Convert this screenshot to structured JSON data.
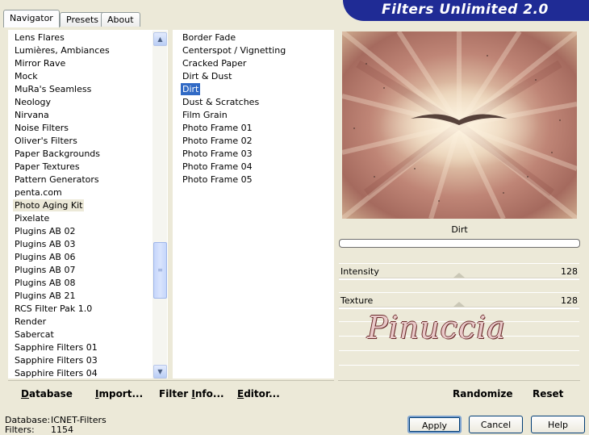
{
  "tabs": [
    "Navigator",
    "Presets",
    "About"
  ],
  "app_title": "Filters Unlimited 2.0",
  "categories": [
    "Lens Flares",
    "Lumières, Ambiances",
    "Mirror Rave",
    "Mock",
    "MuRa's Seamless",
    "Neology",
    "Nirvana",
    "Noise Filters",
    "Oliver's Filters",
    "Paper Backgrounds",
    "Paper Textures",
    "Pattern Generators",
    "penta.com",
    "Photo Aging Kit",
    "Pixelate",
    "Plugins AB 02",
    "Plugins AB 03",
    "Plugins AB 06",
    "Plugins AB 07",
    "Plugins AB 08",
    "Plugins AB 21",
    "RCS Filter Pak 1.0",
    "Render",
    "Sabercat",
    "Sapphire Filters 01",
    "Sapphire Filters 03",
    "Sapphire Filters 04"
  ],
  "selected_category": "Photo Aging Kit",
  "filters": [
    "Border Fade",
    "Centerspot / Vignetting",
    "Cracked Paper",
    "Dirt & Dust",
    "Dirt",
    "Dust & Scratches",
    "Film Grain",
    "Photo Frame 01",
    "Photo Frame 02",
    "Photo Frame 03",
    "Photo Frame 04",
    "Photo Frame 05"
  ],
  "selected_filter": "Dirt",
  "left_buttons": {
    "database": {
      "u": "D",
      "rest": "atabase"
    },
    "import": {
      "u": "I",
      "rest": "mport..."
    },
    "filter_info": {
      "pre": "Filter ",
      "u": "I",
      "rest": "nfo..."
    },
    "editor": {
      "u": "E",
      "rest": "ditor..."
    }
  },
  "preview_label": "Dirt",
  "sliders": [
    {
      "label": "Intensity",
      "value": "128"
    },
    {
      "label": "Texture",
      "value": "128"
    }
  ],
  "watermark": "Pinuccia",
  "right_buttons": {
    "randomize": "Randomize",
    "reset": "Reset"
  },
  "status": {
    "db_key": "Database:",
    "db_val": "ICNET-Filters",
    "filters_key": "Filters:",
    "filters_val": "1154"
  },
  "dialog_buttons": {
    "apply": "Apply",
    "cancel": "Cancel",
    "help": "Help"
  },
  "colors": {
    "banner": "#1f2b95",
    "selection": "#316ac5",
    "dialog_bg": "#ece9d8"
  }
}
